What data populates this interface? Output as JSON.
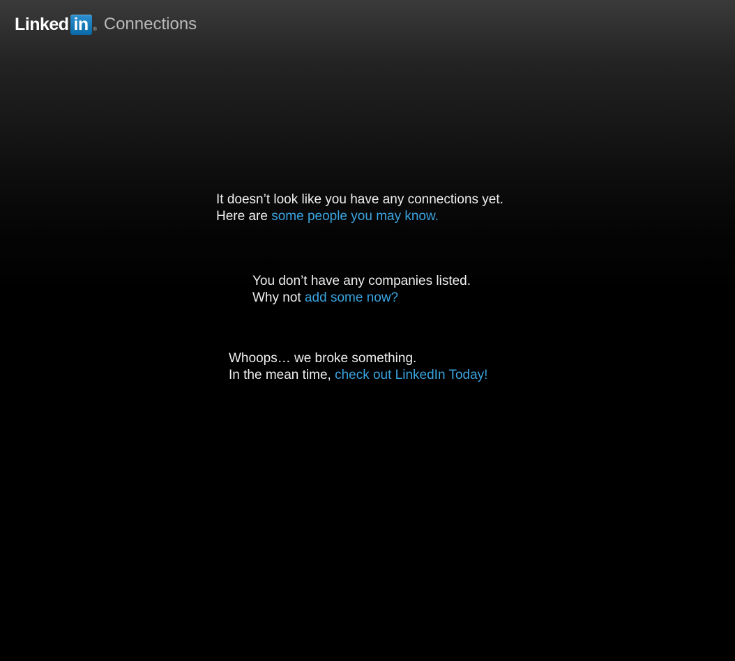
{
  "header": {
    "logo_text": "Linked",
    "logo_box_text": "in",
    "logo_registered": "®",
    "section_title": "Connections"
  },
  "messages": [
    {
      "line1": "It doesn’t look like you have any connections yet.",
      "line2_prefix": "Here are ",
      "link": "some people you may know."
    },
    {
      "line1": "You don’t have any companies listed.",
      "line2_prefix": "Why not ",
      "link": "add some now?"
    },
    {
      "line1": "Whoops… we broke something.",
      "line2_prefix": "In the mean time, ",
      "link": "check out LinkedIn Today!"
    }
  ],
  "colors": {
    "link": "#3aa4e0",
    "text": "#f0f0f0",
    "section_title": "#b8b8b8",
    "logo_blue": "#0a6aa8"
  }
}
